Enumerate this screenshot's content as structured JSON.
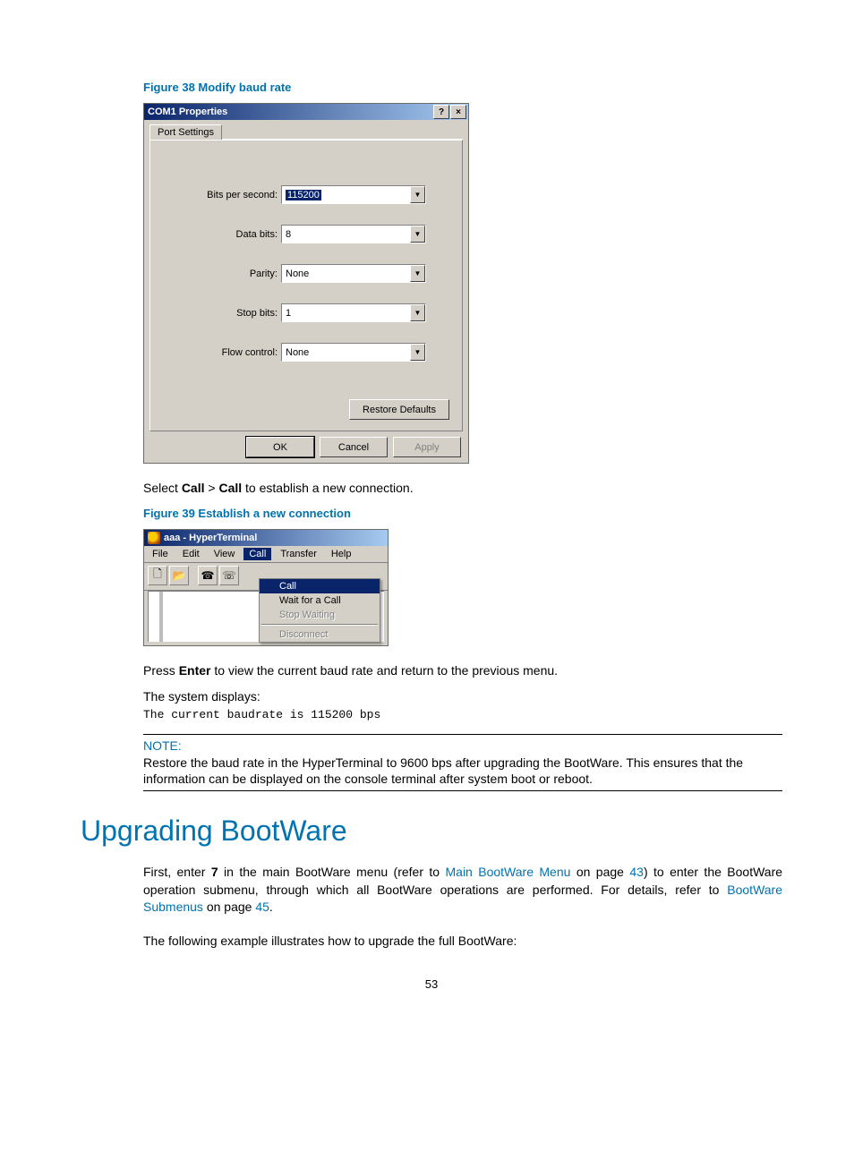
{
  "figure38": {
    "caption": "Figure 38 Modify baud rate",
    "dialog": {
      "title": "COM1 Properties",
      "help_glyph": "?",
      "close_glyph": "×",
      "tab": "Port Settings",
      "fields": {
        "bps": {
          "label": "Bits per second:",
          "value": "115200"
        },
        "data": {
          "label": "Data bits:",
          "value": "8"
        },
        "parity": {
          "label": "Parity:",
          "value": "None"
        },
        "stop": {
          "label": "Stop bits:",
          "value": "1"
        },
        "flow": {
          "label": "Flow control:",
          "value": "None"
        }
      },
      "restore": "Restore Defaults",
      "ok": "OK",
      "cancel": "Cancel",
      "apply": "Apply"
    }
  },
  "text1_pre": "Select ",
  "text1_b1": "Call",
  "text1_mid": " > ",
  "text1_b2": "Call",
  "text1_post": " to establish a new connection.",
  "figure39": {
    "caption": "Figure 39 Establish a new connection",
    "window": {
      "title": "aaa - HyperTerminal",
      "menus": [
        "File",
        "Edit",
        "View",
        "Call",
        "Transfer",
        "Help"
      ],
      "dropdown": {
        "items": [
          {
            "label": "Call",
            "state": "sel"
          },
          {
            "label": "Wait for a Call",
            "state": ""
          },
          {
            "label": "Stop Waiting",
            "state": "dis"
          },
          {
            "sep": true
          },
          {
            "label": "Disconnect",
            "state": "dis"
          }
        ]
      }
    }
  },
  "text2_pre": "Press ",
  "text2_b": "Enter",
  "text2_post": " to view the current baud rate and return to the previous menu.",
  "text3": "The system displays:",
  "mono1": "The current baudrate is 115200 bps",
  "note_label": "NOTE:",
  "note_text": "Restore the baud rate in the HyperTerminal to 9600 bps after upgrading the BootWare. This ensures that the information can be displayed on the console terminal after system boot or reboot.",
  "h1": "Upgrading BootWare",
  "para1_a": "First, enter ",
  "para1_b": "7",
  "para1_c": " in the main BootWare menu (refer to ",
  "para1_link1": "Main BootWare Menu",
  "para1_d": " on page ",
  "para1_page1": "43",
  "para1_e": ") to enter the BootWare operation submenu, through which all BootWare operations are performed. For details, refer to ",
  "para1_link2": "BootWare Submenus",
  "para1_f": " on page ",
  "para1_page2": "45",
  "para1_g": ".",
  "para2": "The following example illustrates how to upgrade the full BootWare:",
  "page_no": "53"
}
